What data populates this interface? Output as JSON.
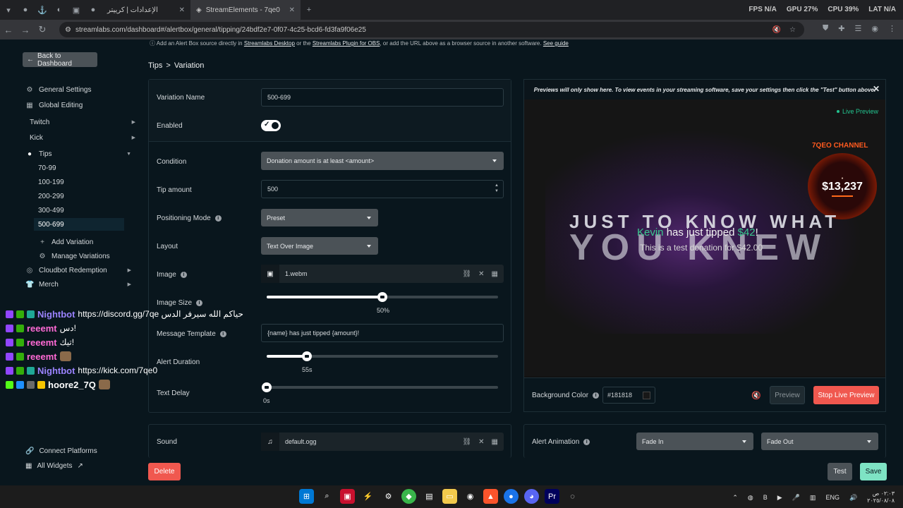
{
  "browser": {
    "tabs": [
      {
        "title": "الإعدادات | كرييتر",
        "close": "✕"
      },
      {
        "title": "StreamElements - 7qe0",
        "close": "✕"
      }
    ],
    "new_tab": "+",
    "overlay": {
      "fps_label": "FPS",
      "fps_value": "N/A",
      "gpu_label": "GPU",
      "gpu_value": "27%",
      "cpu_label": "CPU",
      "cpu_value": "39%",
      "lat_label": "LAT",
      "lat_value": "N/A"
    },
    "url": "streamlabs.com/dashboard#/alertbox/general/tipping/24bdf2e7-0f07-4c25-bcd6-fd3fa9f06e25"
  },
  "page": {
    "info_line": {
      "prefix": "Add an Alert Box source directly in",
      "link1": "Streamlabs Desktop",
      "mid": "or the",
      "link2": "Streamlabs Plugin for OBS",
      "mid2": ", or add the URL above as a browser source in another software.",
      "link3": "See guide"
    },
    "back_label": "Back to Dashboard",
    "breadcrumb": {
      "parent": "Tips",
      "sep": ">",
      "current": "Variation"
    }
  },
  "sidebar": {
    "general_settings": "General Settings",
    "global_editing": "Global Editing",
    "twitch": "Twitch",
    "kick": "Kick",
    "tips": "Tips",
    "variations": [
      "70-99",
      "100-199",
      "200-299",
      "300-499",
      "500-699"
    ],
    "add_variation": "Add Variation",
    "manage_variations": "Manage Variations",
    "cloudbot": "Cloudbot Redemption",
    "merch": "Merch",
    "connect_platforms": "Connect Platforms",
    "all_widgets": "All Widgets"
  },
  "form": {
    "variation_name_label": "Variation Name",
    "variation_name_value": "500-699",
    "enabled_label": "Enabled",
    "condition_label": "Condition",
    "condition_value": "Donation amount is at least <amount>",
    "tip_amount_label": "Tip amount",
    "tip_amount_value": "500",
    "positioning_label": "Positioning Mode",
    "positioning_value": "Preset",
    "layout_label": "Layout",
    "layout_value": "Text Over Image",
    "image_label": "Image",
    "image_file": "1.webm",
    "image_size_label": "Image Size",
    "image_size_value": "50%",
    "image_size_fraction": 0.5,
    "message_template_label": "Message Template",
    "message_template_value": "{name} has just tipped {amount}!",
    "alert_duration_label": "Alert Duration",
    "alert_duration_value": "55s",
    "alert_duration_fraction": 0.175,
    "text_delay_label": "Text Delay",
    "text_delay_value": "0s",
    "text_delay_fraction": 0.0,
    "sound_label": "Sound",
    "sound_file": "default.ogg"
  },
  "preview": {
    "notice": "Previews will only show here. To view events in your streaming software, save your settings then click the \"Test\" button above.",
    "live_label": "Live Preview",
    "channel_name": "7QEO CHANNEL",
    "goal_amount": "$13,237",
    "big_text_1": "JUST TO KNOW WHAT",
    "big_text_2": "YOU KNEW",
    "alert_name": "Kevin",
    "alert_middle": " has just tipped ",
    "alert_amount": "$42",
    "alert_end": "!",
    "alert_sub": "This is a test donation for $42.00",
    "bg_color_label": "Background Color",
    "bg_color_value": "#181818",
    "preview_btn": "Preview",
    "stop_btn": "Stop Live Preview",
    "alert_animation_label": "Alert Animation",
    "anim_in": "Fade In",
    "anim_out": "Fade Out"
  },
  "actions": {
    "delete": "Delete",
    "test": "Test",
    "save": "Save"
  },
  "chat": [
    {
      "user": "Nightbot",
      "color": "#9b83ff",
      "msg": "https://discord.gg/7qe حياكم الله سيرفر الدس"
    },
    {
      "user": "reeemt",
      "color": "#ff6ad5",
      "msg": "دس!"
    },
    {
      "user": "reeemt",
      "color": "#ff6ad5",
      "msg": "تيك!"
    },
    {
      "user": "reeemt",
      "color": "#ff6ad5",
      "msg": ""
    },
    {
      "user": "Nightbot",
      "color": "#9b83ff",
      "msg": "https://kick.com/7qe0"
    },
    {
      "user": "hoore2_7Q",
      "color": "#ffffff",
      "msg": ""
    }
  ],
  "taskbar": {
    "lang": "ENG",
    "time": "٠٢:٠٣ ص",
    "date": "٢٠٢٥/٠٨/٠٨"
  }
}
